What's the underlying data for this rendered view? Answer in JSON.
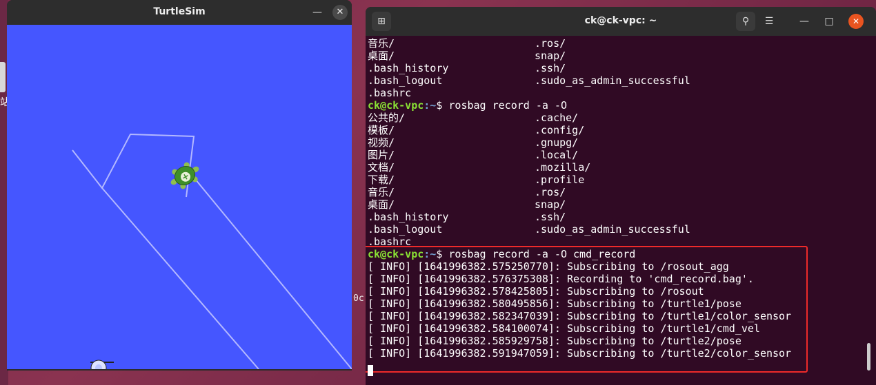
{
  "desktop": {
    "edge_char": "站",
    "partial_text": "0c"
  },
  "turtlesim": {
    "title": "TurtleSim",
    "minimize_icon": "minimize-icon",
    "close_icon": "close-icon",
    "canvas_color": "#4556ff",
    "pen_color": "#b3b8ff"
  },
  "terminal": {
    "title": "ck@ck-vpc: ~",
    "new_tab_icon": "new-tab-icon",
    "search_icon": "search-icon",
    "menu_icon": "hamburger-menu-icon",
    "background_color": "#300a24",
    "lines": [
      {
        "type": "listing",
        "c1": "音乐/",
        "c2": ".ros/"
      },
      {
        "type": "listing",
        "c1": "桌面/",
        "c2": "snap/"
      },
      {
        "type": "listing",
        "c1": ".bash_history",
        "c2": ".ssh/"
      },
      {
        "type": "listing",
        "c1": ".bash_logout",
        "c2": ".sudo_as_admin_successful"
      },
      {
        "type": "listing",
        "c1": ".bashrc",
        "c2": ""
      },
      {
        "type": "prompt",
        "user": "ck@ck-vpc",
        "path": ":~",
        "cmd": "$ rosbag record -a -O"
      },
      {
        "type": "listing",
        "c1": "公共的/",
        "c2": ".cache/"
      },
      {
        "type": "listing",
        "c1": "模板/",
        "c2": ".config/"
      },
      {
        "type": "listing",
        "c1": "视频/",
        "c2": ".gnupg/"
      },
      {
        "type": "listing",
        "c1": "图片/",
        "c2": ".local/"
      },
      {
        "type": "listing",
        "c1": "文档/",
        "c2": ".mozilla/"
      },
      {
        "type": "listing",
        "c1": "下载/",
        "c2": ".profile"
      },
      {
        "type": "listing",
        "c1": "音乐/",
        "c2": ".ros/"
      },
      {
        "type": "listing",
        "c1": "桌面/",
        "c2": "snap/"
      },
      {
        "type": "listing",
        "c1": ".bash_history",
        "c2": ".ssh/"
      },
      {
        "type": "listing",
        "c1": ".bash_logout",
        "c2": ".sudo_as_admin_successful"
      },
      {
        "type": "listing",
        "c1": ".bashrc",
        "c2": ""
      },
      {
        "type": "prompt",
        "user": "ck@ck-vpc",
        "path": ":~",
        "cmd": "$ rosbag record -a -O cmd_record"
      },
      {
        "type": "text",
        "text": "[ INFO] [1641996382.575250770]: Subscribing to /rosout_agg"
      },
      {
        "type": "text",
        "text": "[ INFO] [1641996382.576375308]: Recording to 'cmd_record.bag'."
      },
      {
        "type": "text",
        "text": "[ INFO] [1641996382.578425805]: Subscribing to /rosout"
      },
      {
        "type": "text",
        "text": "[ INFO] [1641996382.580495856]: Subscribing to /turtle1/pose"
      },
      {
        "type": "text",
        "text": "[ INFO] [1641996382.582347039]: Subscribing to /turtle1/color_sensor"
      },
      {
        "type": "text",
        "text": "[ INFO] [1641996382.584100074]: Subscribing to /turtle1/cmd_vel"
      },
      {
        "type": "text",
        "text": "[ INFO] [1641996382.585929758]: Subscribing to /turtle2/pose"
      },
      {
        "type": "text",
        "text": "[ INFO] [1641996382.591947059]: Subscribing to /turtle2/color_sensor"
      }
    ]
  }
}
